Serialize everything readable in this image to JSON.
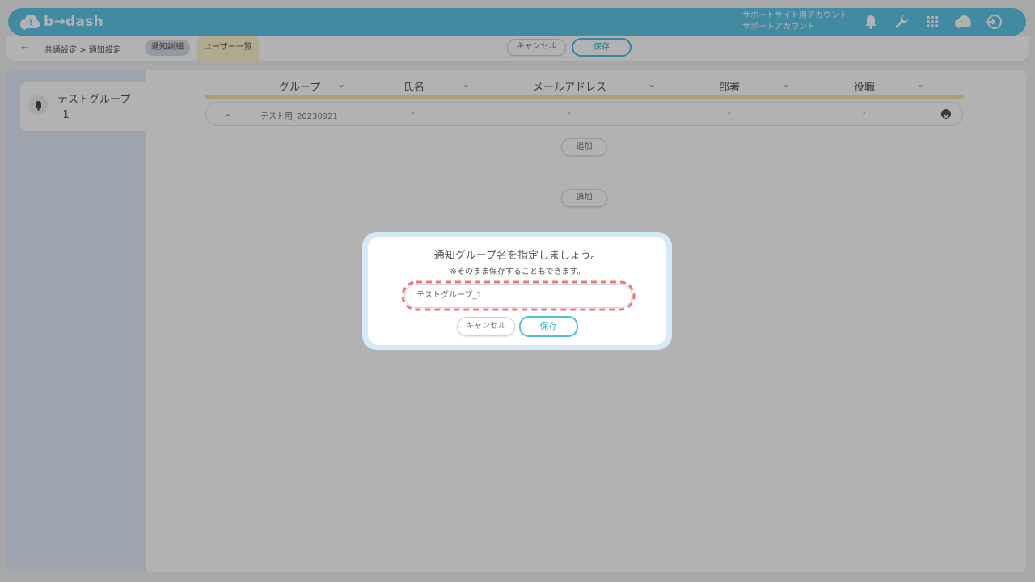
{
  "app": {
    "logo": "b→dash"
  },
  "header": {
    "account_line1": "サポートサイト用アカウント",
    "account_line2": "サポートアカウント",
    "icons": [
      "bell-icon",
      "wrench-icon",
      "apps-grid-icon",
      "chat-cloud-icon",
      "logout-icon"
    ]
  },
  "subheader": {
    "back": "←",
    "breadcrumb": "共通設定 > 通知設定",
    "tab_detail": "通知詳細",
    "tab_users": "ユーザー一覧",
    "cancel": "キャンセル",
    "save": "保存"
  },
  "sidebar": {
    "group_name": "テストグループ_1"
  },
  "table": {
    "columns": [
      "グループ",
      "氏名",
      "メールアドレス",
      "部署",
      "役職"
    ],
    "row": {
      "group": "テスト用_20230921",
      "name": "-",
      "email": "-",
      "dept": "-",
      "title": "-"
    },
    "add_label": "追加",
    "add_label_2": "追加"
  },
  "dialog": {
    "title": "通知グループ名を指定しましょう。",
    "subtitle": "※そのまま保存することもできます。",
    "input_value": "テストグループ_1",
    "cancel": "キャンセル",
    "save": "保存"
  },
  "colors": {
    "brand": "#5fc4e8",
    "highlight_dash": "#f2757c",
    "tab_users_bg": "#fdf2cc"
  }
}
